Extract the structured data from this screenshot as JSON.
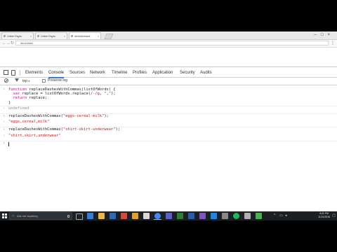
{
  "browser": {
    "tabs": [
      {
        "title": "Online Pages"
      },
      {
        "title": "Online Pages"
      },
      {
        "title": "devtools/blank"
      }
    ],
    "address": "about:blank"
  },
  "devtools": {
    "tabs": [
      "Elements",
      "Console",
      "Sources",
      "Network",
      "Timeline",
      "Profiles",
      "Application",
      "Security",
      "Audits"
    ],
    "active_tab": "Console",
    "context": "top",
    "preserve_log_label": "Preserve log"
  },
  "console": {
    "fn_lines": [
      [
        "function",
        " replaceDashesWithCommas(listOfWords) {"
      ],
      [
        "  var",
        " replace = listOfWords.replace(",
        "/-/g",
        ", ",
        "\",\"",
        ");"
      ],
      [
        "  return",
        " replace;"
      ],
      [
        "}"
      ]
    ],
    "undefined": "undefined",
    "call1_fn": "replaceDashesWithCommas(",
    "call1_arg": "\"eggs-cereal-milk\"",
    "call1_end": ");",
    "result1": "\"eggs,cereal,milk\"",
    "call2_fn": "replaceDashesWithCommas(",
    "call2_arg": "\"shirt-skirt-underwear\"",
    "call2_end": ");",
    "result2": "\"shirt,skirt,underwear\""
  },
  "taskbar": {
    "search_placeholder": "Ask me anything",
    "time": "8:41 PM",
    "date": "11/21/2016"
  },
  "colors": {
    "accent": "#3879d9",
    "string": "#c41a16",
    "keyword": "#aa0d91"
  }
}
